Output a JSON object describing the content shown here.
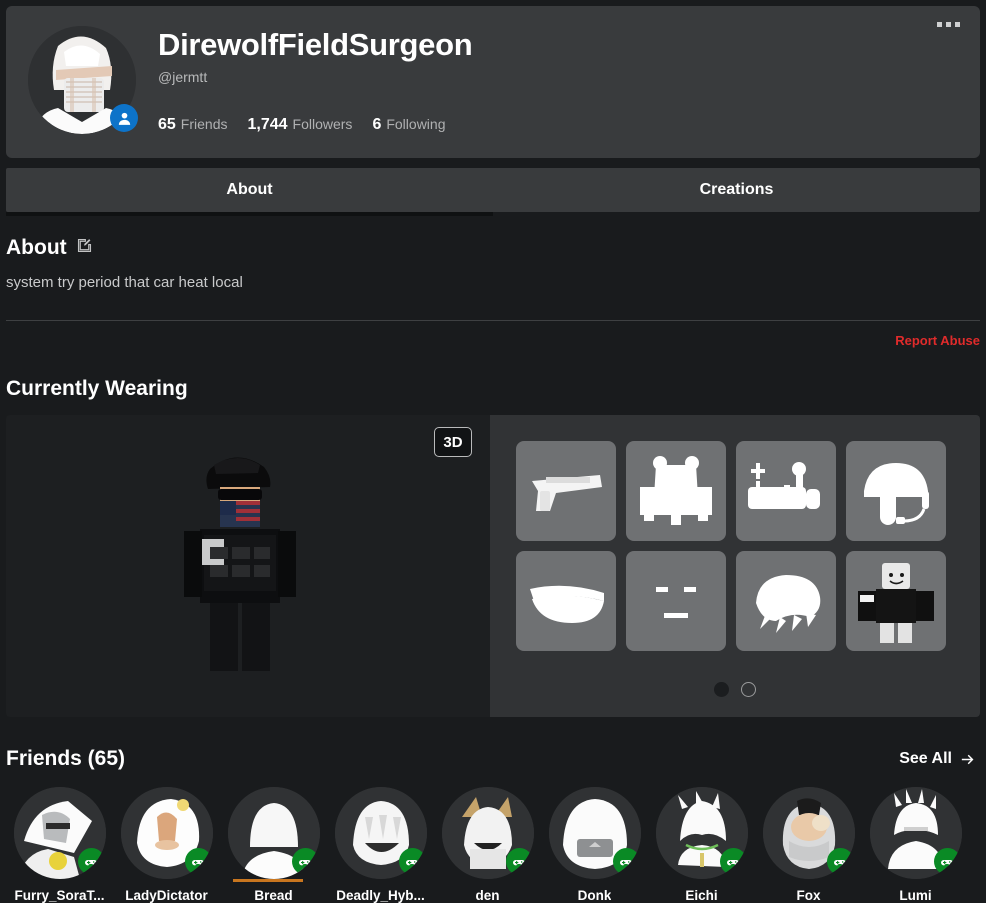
{
  "profile": {
    "display_name": "DirewolfFieldSurgeon",
    "handle": "@jermtt",
    "avatar_badge_icon": "person-icon",
    "menu_icon": "more-options-icon",
    "stats": [
      {
        "value": "65",
        "label": "Friends"
      },
      {
        "value": "1,744",
        "label": "Followers"
      },
      {
        "value": "6",
        "label": "Following"
      }
    ]
  },
  "tabs": [
    {
      "label": "About",
      "active": true
    },
    {
      "label": "Creations",
      "active": false
    }
  ],
  "about": {
    "heading": "About",
    "edit_icon": "edit-pencil-icon",
    "description": "system try period that car heat local",
    "report_label": "Report Abuse",
    "report_color": "#e02b2b"
  },
  "currently_wearing": {
    "heading": "Currently Wearing",
    "view_3d_label": "3D",
    "items": [
      {
        "name": "pistol"
      },
      {
        "name": "tactical-vest"
      },
      {
        "name": "gear-pack"
      },
      {
        "name": "helmet-headset"
      },
      {
        "name": "sunglasses"
      },
      {
        "name": "face"
      },
      {
        "name": "hair"
      },
      {
        "name": "avatar-outfit"
      }
    ],
    "pages": [
      {
        "active": true
      },
      {
        "active": false
      }
    ]
  },
  "friends": {
    "heading": "Friends (65)",
    "see_all_label": "See All",
    "see_all_icon": "arrow-right-icon",
    "status_icon": "gamepad-icon",
    "list": [
      {
        "name": "Furry_SoraT..."
      },
      {
        "name": "LadyDictator"
      },
      {
        "name": "Bread"
      },
      {
        "name": "Deadly_Hyb..."
      },
      {
        "name": "den"
      },
      {
        "name": "Donk"
      },
      {
        "name": "Eichi"
      },
      {
        "name": "Fox"
      },
      {
        "name": "Lumi"
      }
    ]
  }
}
